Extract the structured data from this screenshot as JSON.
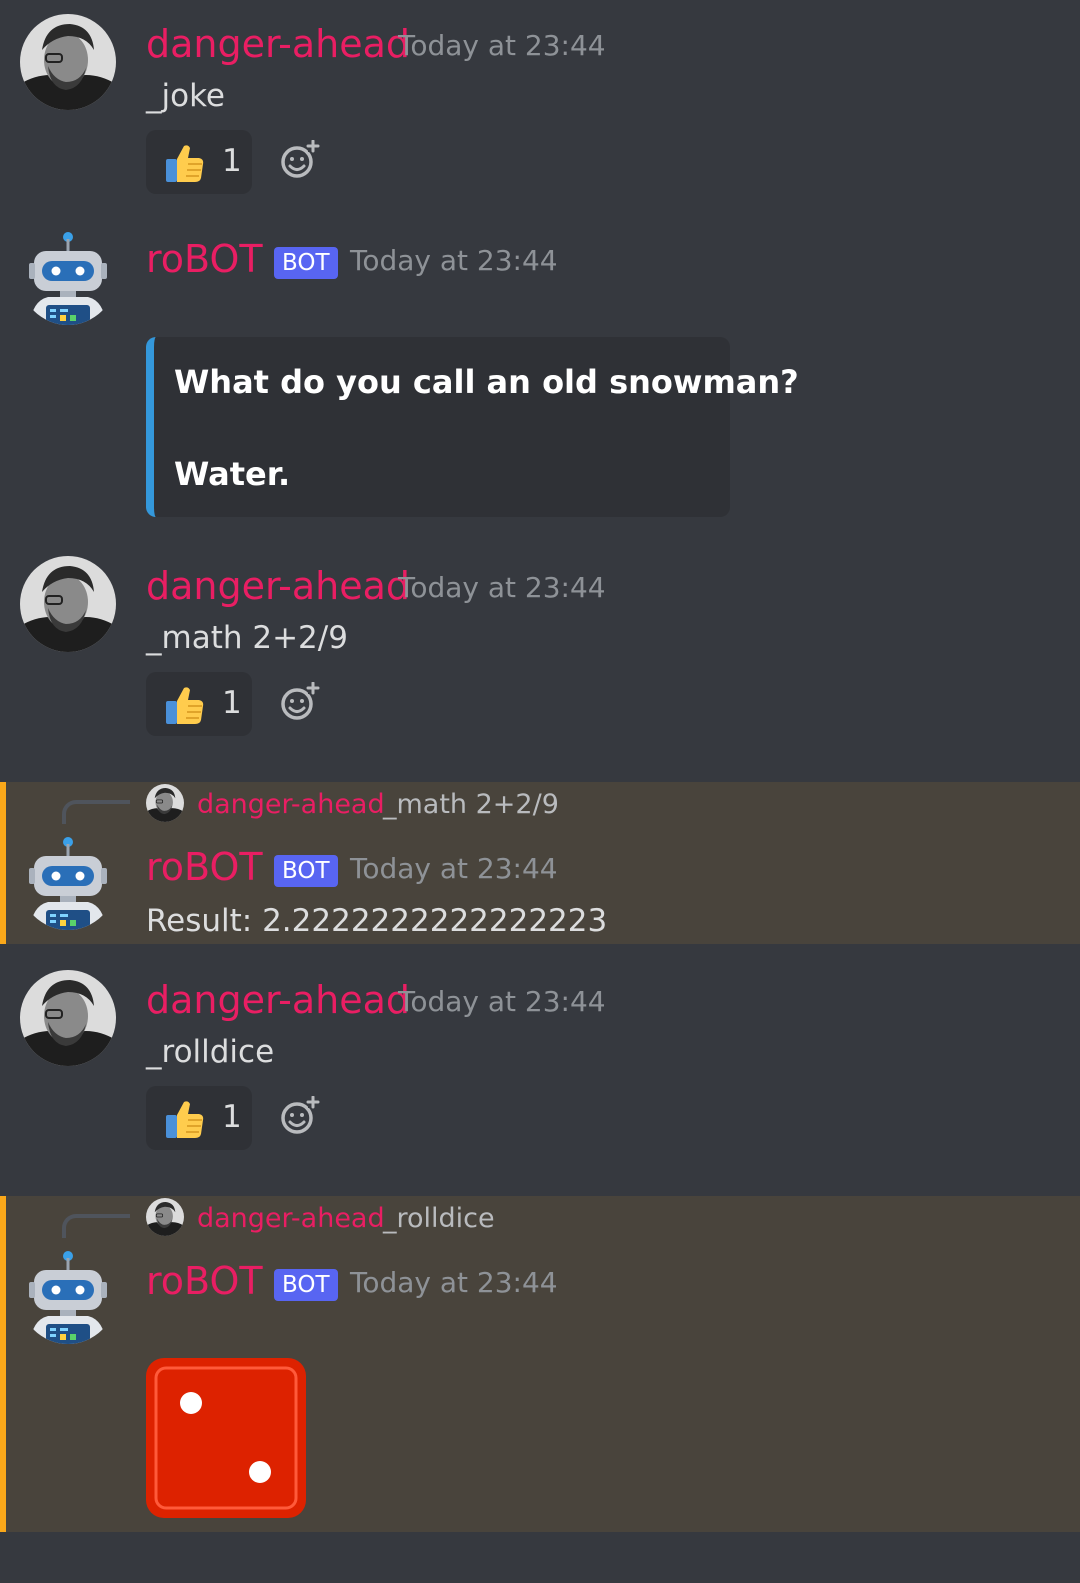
{
  "messages": [
    {
      "author": "danger-ahead",
      "timestamp": "Today at 23:44",
      "content": "_joke",
      "reaction": {
        "emoji": "thumbs-up",
        "count": "1"
      }
    },
    {
      "author": "roBOT",
      "badge": "BOT",
      "timestamp": "Today at 23:44",
      "embed": {
        "line1": "What do you call an old snowman?",
        "line2": "Water.",
        "border_color": "#3498db"
      }
    },
    {
      "author": "danger-ahead",
      "timestamp": "Today at 23:44",
      "content": "_math 2+2/9",
      "reaction": {
        "emoji": "thumbs-up",
        "count": "1"
      }
    },
    {
      "reply_to": {
        "author": "danger-ahead",
        "content": "_math 2+2/9"
      },
      "author": "roBOT",
      "badge": "BOT",
      "timestamp": "Today at 23:44",
      "content": "Result: 2.2222222222222223"
    },
    {
      "author": "danger-ahead",
      "timestamp": "Today at 23:44",
      "content": "_rolldice",
      "reaction": {
        "emoji": "thumbs-up",
        "count": "1"
      }
    },
    {
      "reply_to": {
        "author": "danger-ahead",
        "content": "_rolldice"
      },
      "author": "roBOT",
      "badge": "BOT",
      "timestamp": "Today at 23:44",
      "attachment": {
        "type": "dice-image",
        "face": 2,
        "color": "#dd2200"
      }
    }
  ],
  "colors": {
    "background": "#36393f",
    "mention_highlight": "#49443c",
    "mention_bar": "#faa81a",
    "username": "#e91e63",
    "bot_badge": "#5865f2"
  }
}
